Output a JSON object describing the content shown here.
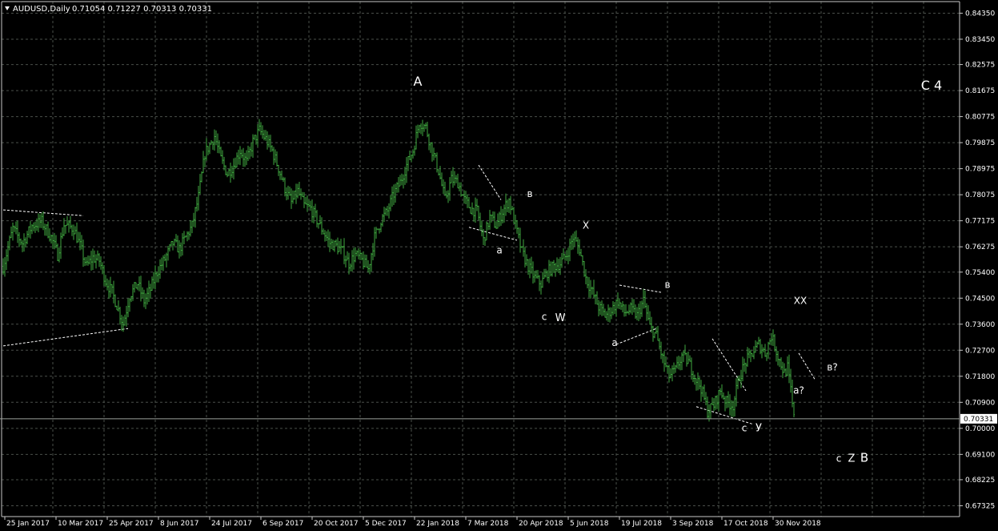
{
  "header": {
    "symbol": "AUDUSD,Daily",
    "ohlc": "0.71054 0.71227 0.70313 0.70331",
    "triangle_icon": "triangle-down-icon"
  },
  "colors": {
    "background": "#000000",
    "grid": "#4a4f4a",
    "bars": "#3fa83f",
    "axis": "#c8c8c8",
    "text": "#ffffff",
    "price_line": "#9aa09a"
  },
  "current_price": 0.70331,
  "current_price_label": "0.70331",
  "chart_data": {
    "type": "ohlc_bar",
    "symbol": "AUDUSD",
    "timeframe": "Daily",
    "ylim": [
      0.6695,
      0.8475
    ],
    "grid": true,
    "y_ticks": [
      "0.84350",
      "0.83450",
      "0.82575",
      "0.81675",
      "0.80775",
      "0.79875",
      "0.78975",
      "0.78075",
      "0.77175",
      "0.76275",
      "0.75400",
      "0.74500",
      "0.73600",
      "0.72700",
      "0.71800",
      "0.70900",
      "0.70000",
      "0.69100",
      "0.68225",
      "0.67325"
    ],
    "y_tick_values": [
      0.8435,
      0.8345,
      0.82575,
      0.81675,
      0.80775,
      0.79875,
      0.78975,
      0.78075,
      0.77175,
      0.76275,
      0.754,
      0.745,
      0.736,
      0.727,
      0.718,
      0.709,
      0.7,
      0.691,
      0.68225,
      0.67325
    ],
    "x_ticks": [
      "25 Jan 2017",
      "10 Mar 2017",
      "25 Apr 2017",
      "8 Jun 2017",
      "24 Jul 2017",
      "6 Sep 2017",
      "20 Oct 2017",
      "5 Dec 2017",
      "22 Jan 2018",
      "7 Mar 2018",
      "20 Apr 2018",
      "5 Jun 2018",
      "19 Jul 2018",
      "3 Sep 2018",
      "17 Oct 2018",
      "30 Nov 2018"
    ],
    "x_tick_bar_index": [
      9,
      41,
      73,
      105,
      137,
      169,
      201,
      233,
      265,
      297,
      329,
      361,
      393,
      425,
      457,
      489
    ],
    "bar_count": 495,
    "close_path": [
      [
        0,
        0.756
      ],
      [
        6,
        0.769
      ],
      [
        12,
        0.764
      ],
      [
        18,
        0.77
      ],
      [
        24,
        0.7715
      ],
      [
        30,
        0.766
      ],
      [
        34,
        0.76
      ],
      [
        38,
        0.7705
      ],
      [
        44,
        0.769
      ],
      [
        48,
        0.763
      ],
      [
        52,
        0.756
      ],
      [
        56,
        0.759
      ],
      [
        60,
        0.758
      ],
      [
        64,
        0.751
      ],
      [
        68,
        0.747
      ],
      [
        72,
        0.741
      ],
      [
        75,
        0.736
      ],
      [
        79,
        0.746
      ],
      [
        84,
        0.75
      ],
      [
        88,
        0.744
      ],
      [
        92,
        0.748
      ],
      [
        96,
        0.754
      ],
      [
        100,
        0.7575
      ],
      [
        106,
        0.764
      ],
      [
        110,
        0.762
      ],
      [
        114,
        0.766
      ],
      [
        118,
        0.77
      ],
      [
        122,
        0.78
      ],
      [
        126,
        0.795
      ],
      [
        132,
        0.801
      ],
      [
        136,
        0.793
      ],
      [
        140,
        0.788
      ],
      [
        144,
        0.791
      ],
      [
        148,
        0.796
      ],
      [
        152,
        0.792
      ],
      [
        156,
        0.799
      ],
      [
        160,
        0.803
      ],
      [
        164,
        0.8
      ],
      [
        168,
        0.796
      ],
      [
        172,
        0.79
      ],
      [
        176,
        0.783
      ],
      [
        180,
        0.778
      ],
      [
        184,
        0.782
      ],
      [
        188,
        0.777
      ],
      [
        192,
        0.776
      ],
      [
        196,
        0.772
      ],
      [
        200,
        0.768
      ],
      [
        204,
        0.764
      ],
      [
        208,
        0.763
      ],
      [
        212,
        0.761
      ],
      [
        216,
        0.757
      ],
      [
        220,
        0.76
      ],
      [
        224,
        0.758
      ],
      [
        228,
        0.755
      ],
      [
        232,
        0.766
      ],
      [
        236,
        0.772
      ],
      [
        240,
        0.775
      ],
      [
        244,
        0.781
      ],
      [
        248,
        0.785
      ],
      [
        252,
        0.791
      ],
      [
        256,
        0.796
      ],
      [
        260,
        0.806
      ],
      [
        264,
        0.804
      ],
      [
        268,
        0.796
      ],
      [
        272,
        0.789
      ],
      [
        276,
        0.779
      ],
      [
        280,
        0.786
      ],
      [
        284,
        0.785
      ],
      [
        288,
        0.779
      ],
      [
        292,
        0.776
      ],
      [
        296,
        0.775
      ],
      [
        300,
        0.765
      ],
      [
        304,
        0.773
      ],
      [
        308,
        0.77
      ],
      [
        312,
        0.775
      ],
      [
        316,
        0.779
      ],
      [
        320,
        0.77
      ],
      [
        324,
        0.761
      ],
      [
        328,
        0.756
      ],
      [
        332,
        0.752
      ],
      [
        336,
        0.75
      ],
      [
        340,
        0.754
      ],
      [
        344,
        0.756
      ],
      [
        348,
        0.757
      ],
      [
        352,
        0.76
      ],
      [
        356,
        0.766
      ],
      [
        360,
        0.762
      ],
      [
        364,
        0.752
      ],
      [
        368,
        0.747
      ],
      [
        372,
        0.742
      ],
      [
        376,
        0.739
      ],
      [
        380,
        0.741
      ],
      [
        384,
        0.744
      ],
      [
        388,
        0.74
      ],
      [
        392,
        0.741
      ],
      [
        396,
        0.739
      ],
      [
        400,
        0.744
      ],
      [
        404,
        0.735
      ],
      [
        408,
        0.732
      ],
      [
        412,
        0.724
      ],
      [
        416,
        0.718
      ],
      [
        420,
        0.72
      ],
      [
        424,
        0.725
      ],
      [
        428,
        0.723
      ],
      [
        432,
        0.718
      ],
      [
        436,
        0.714
      ],
      [
        440,
        0.706
      ],
      [
        444,
        0.708
      ],
      [
        448,
        0.713
      ],
      [
        452,
        0.709
      ],
      [
        456,
        0.708
      ],
      [
        460,
        0.718
      ],
      [
        464,
        0.723
      ],
      [
        468,
        0.726
      ],
      [
        472,
        0.729
      ],
      [
        476,
        0.726
      ],
      [
        480,
        0.732
      ],
      [
        484,
        0.725
      ],
      [
        488,
        0.719
      ],
      [
        490,
        0.721
      ],
      [
        492,
        0.713
      ],
      [
        494,
        0.7033
      ]
    ],
    "annotations": [
      {
        "text": "A",
        "bar": 259,
        "price": 0.8185,
        "size": 16
      },
      {
        "text": "в",
        "bar": 329,
        "price": 0.78,
        "size": 12
      },
      {
        "text": "а",
        "bar": 310,
        "price": 0.7605,
        "size": 12
      },
      {
        "text": "X",
        "bar": 364,
        "price": 0.769,
        "size": 12
      },
      {
        "text": "c",
        "bar": 338,
        "price": 0.7375,
        "size": 12
      },
      {
        "text": "W",
        "bar": 348,
        "price": 0.737,
        "size": 13
      },
      {
        "text": "в",
        "bar": 415,
        "price": 0.7485,
        "size": 12
      },
      {
        "text": "а",
        "bar": 382,
        "price": 0.7285,
        "size": 12
      },
      {
        "text": "XX",
        "bar": 498,
        "price": 0.743,
        "size": 12
      },
      {
        "text": "в?",
        "bar": 518,
        "price": 0.72,
        "size": 12
      },
      {
        "text": "а?",
        "bar": 497,
        "price": 0.712,
        "size": 12
      },
      {
        "text": "c",
        "bar": 463,
        "price": 0.699,
        "size": 12
      },
      {
        "text": "У",
        "bar": 472,
        "price": 0.699,
        "size": 13
      },
      {
        "text": "c",
        "bar": 522,
        "price": 0.6885,
        "size": 12
      },
      {
        "text": "Z",
        "bar": 530,
        "price": 0.6885,
        "size": 13
      },
      {
        "text": "B",
        "bar": 538,
        "price": 0.6885,
        "size": 15
      },
      {
        "text": "C 4",
        "bar": 580,
        "price": 0.817,
        "size": 16
      }
    ],
    "trendlines": [
      [
        [
          0,
          0.7755
        ],
        [
          50,
          0.7735
        ]
      ],
      [
        [
          0,
          0.7285
        ],
        [
          78,
          0.7345
        ]
      ],
      [
        [
          297,
          0.791
        ],
        [
          311,
          0.779
        ]
      ],
      [
        [
          291,
          0.7695
        ],
        [
          321,
          0.765
        ]
      ],
      [
        [
          385,
          0.7495
        ],
        [
          411,
          0.747
        ]
      ],
      [
        [
          383,
          0.729
        ],
        [
          408,
          0.7345
        ]
      ],
      [
        [
          443,
          0.731
        ],
        [
          464,
          0.713
        ]
      ],
      [
        [
          433,
          0.7075
        ],
        [
          468,
          0.7015
        ]
      ],
      [
        [
          497,
          0.726
        ],
        [
          507,
          0.717
        ]
      ]
    ]
  }
}
